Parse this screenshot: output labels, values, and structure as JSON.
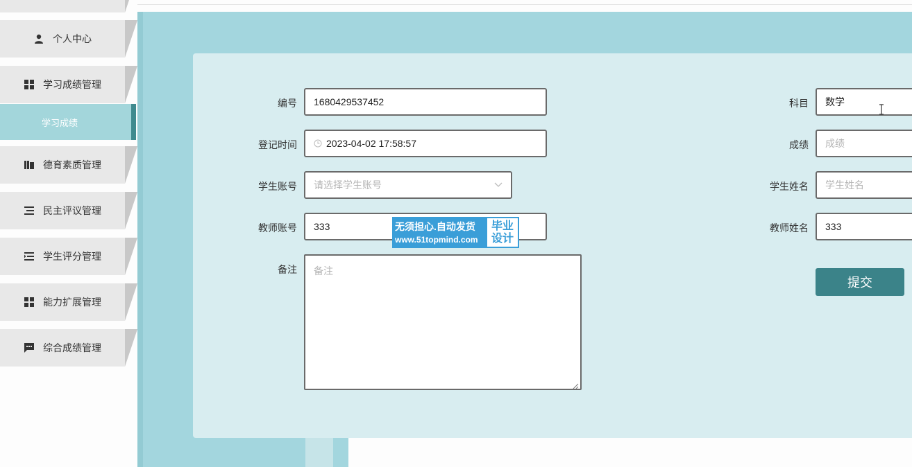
{
  "sidebar": {
    "items": [
      {
        "label": "个人中心",
        "icon": "person-icon"
      },
      {
        "label": "学习成绩管理",
        "icon": "grid-icon"
      },
      {
        "label": "德育素质管理",
        "icon": "books-icon"
      },
      {
        "label": "民主评议管理",
        "icon": "list-icon"
      },
      {
        "label": "学生评分管理",
        "icon": "indent-list-icon"
      },
      {
        "label": "能力扩展管理",
        "icon": "grid-icon"
      },
      {
        "label": "综合成绩管理",
        "icon": "chat-icon"
      }
    ],
    "active_sub": "学习成绩"
  },
  "form": {
    "bianhao": {
      "label": "编号",
      "value": "1680429537452"
    },
    "dengji": {
      "label": "登记时间",
      "value": "2023-04-02 17:58:57"
    },
    "xuesheng_zhanghao": {
      "label": "学生账号",
      "placeholder": "请选择学生账号"
    },
    "jiaoshi_zhanghao": {
      "label": "教师账号",
      "value": "333"
    },
    "beizhu": {
      "label": "备注",
      "placeholder": "备注"
    },
    "kemu": {
      "label": "科目",
      "value": "数学"
    },
    "chengji": {
      "label": "成绩",
      "placeholder": "成绩"
    },
    "xuesheng_xingming": {
      "label": "学生姓名",
      "placeholder": "学生姓名"
    },
    "jiaoshi_xingming": {
      "label": "教师姓名",
      "value": "333"
    },
    "submit_label": "提交"
  },
  "watermark": {
    "line1": "无须担心.自动发货",
    "line2": "www.51topmind.com",
    "badge1": "毕业",
    "badge2": "设计"
  },
  "colors": {
    "accent": "#3b8389",
    "main_bg": "#a3d6de",
    "card_bg": "#d8edf0"
  }
}
